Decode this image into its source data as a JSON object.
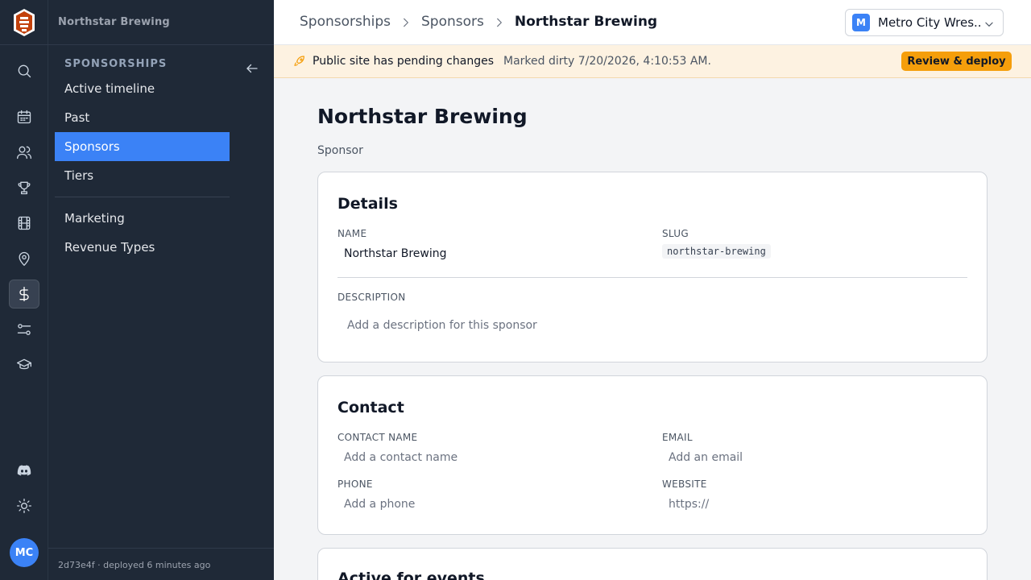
{
  "brand": {
    "name": "Northstar Brewing"
  },
  "rail": {
    "items": [
      {
        "icon": "search-icon"
      },
      {
        "icon": "calendar-icon"
      },
      {
        "icon": "users-icon"
      },
      {
        "icon": "trophy-icon"
      },
      {
        "icon": "film-icon"
      },
      {
        "icon": "map-pin-icon"
      },
      {
        "icon": "dollar-icon",
        "active": true
      },
      {
        "icon": "sliders-icon"
      },
      {
        "icon": "graduation-cap-icon"
      },
      {
        "icon": "discord-icon"
      },
      {
        "icon": "sun-icon"
      }
    ],
    "avatar_initials": "MC"
  },
  "sidebar": {
    "section_title": "SPONSORSHIPS",
    "items": [
      {
        "label": "Active timeline"
      },
      {
        "label": "Past"
      },
      {
        "label": "Sponsors",
        "active": true
      },
      {
        "label": "Tiers"
      },
      {
        "label": "Marketing"
      },
      {
        "label": "Revenue Types"
      }
    ],
    "footer": "2d73e4f  · deployed 6 minutes ago"
  },
  "breadcrumb": {
    "items": [
      "Sponsorships",
      "Sponsors",
      "Northstar Brewing"
    ]
  },
  "org_switcher": {
    "badge": "M",
    "name": "Metro City Wres..."
  },
  "banner": {
    "title": "Public site has pending changes",
    "subtitle": "Marked dirty 7/20/2026, 4:10:53 AM.",
    "button": "Review & deploy"
  },
  "page": {
    "title": "Northstar Brewing",
    "subtitle": "Sponsor"
  },
  "details": {
    "title": "Details",
    "name_label": "NAME",
    "name_value": "Northstar Brewing",
    "slug_label": "SLUG",
    "slug_value": "northstar-brewing",
    "description_label": "DESCRIPTION",
    "description_placeholder": "Add a description for this sponsor"
  },
  "contact": {
    "title": "Contact",
    "contact_name_label": "CONTACT NAME",
    "contact_name_placeholder": "Add a contact name",
    "email_label": "EMAIL",
    "email_placeholder": "Add an email",
    "phone_label": "PHONE",
    "phone_placeholder": "Add a phone",
    "website_label": "WEBSITE",
    "website_placeholder": "https://"
  },
  "events": {
    "title": "Active for events"
  },
  "colors": {
    "accent": "#3b82f6",
    "sidebar_bg": "#1f2937",
    "banner_bg": "#fdf2e1",
    "warning": "#f59e0b"
  }
}
